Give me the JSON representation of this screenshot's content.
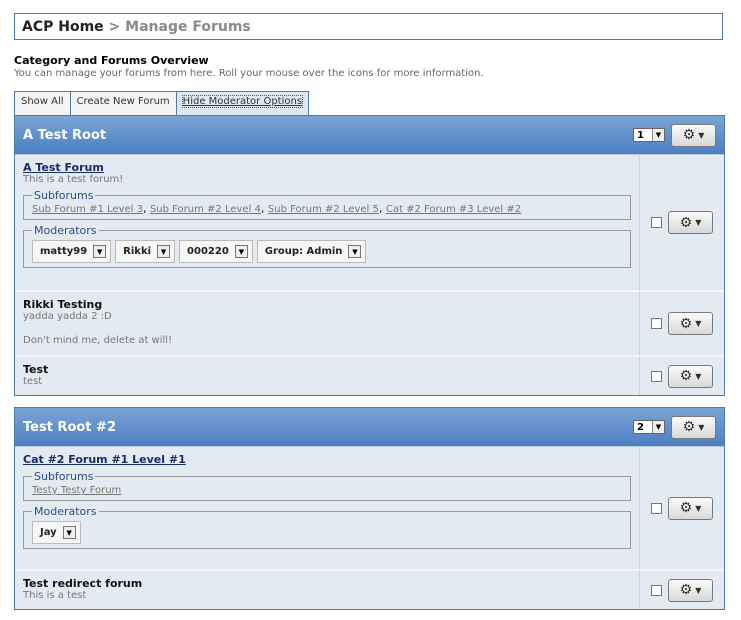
{
  "breadcrumb": {
    "home": "ACP Home",
    "separator": ">",
    "current": "Manage Forums"
  },
  "overview": {
    "title": "Category and Forums Overview",
    "description": "You can manage your forums from here. Roll your mouse over the icons for more information."
  },
  "tabs": [
    "Show All",
    "Create New Forum",
    "Hide Moderator Options"
  ],
  "categories": [
    {
      "name": "A Test Root",
      "order": "1",
      "forums": [
        {
          "name": "A Test Forum",
          "description": "This is a test forum!",
          "subforums_legend": "Subforums",
          "subforums": [
            "Sub Forum #1 Level 3",
            "Sub Forum #2 Level 4",
            "Sub Forum #2 Level 5",
            "Cat #2 Forum #3 Level #2"
          ],
          "moderators_legend": "Moderators",
          "moderators": [
            "matty99",
            "Rikki",
            "000220",
            "Group: Admin"
          ]
        },
        {
          "name": "Rikki Testing",
          "description": "yadda yadda 2 :D",
          "note": "Don't mind me, delete at will!"
        },
        {
          "name": "Test",
          "description": "test"
        }
      ]
    },
    {
      "name": "Test Root #2",
      "order": "2",
      "forums": [
        {
          "name": "Cat #2 Forum #1 Level #1",
          "description": "",
          "subforums_legend": "Subforums",
          "subforums": [
            "Testy Testy Forum"
          ],
          "moderators_legend": "Moderators",
          "moderators": [
            "Jay"
          ]
        },
        {
          "name": "Test redirect forum",
          "description": "This is a test"
        }
      ]
    }
  ],
  "icons": {
    "gear": "gear-icon",
    "dropdown": "chevron-down-icon"
  },
  "colors": {
    "header_start": "#7aa5d6",
    "header_end": "#4d7fc0",
    "border": "#4d7aa8",
    "body_bg": "#e3eaf2"
  }
}
